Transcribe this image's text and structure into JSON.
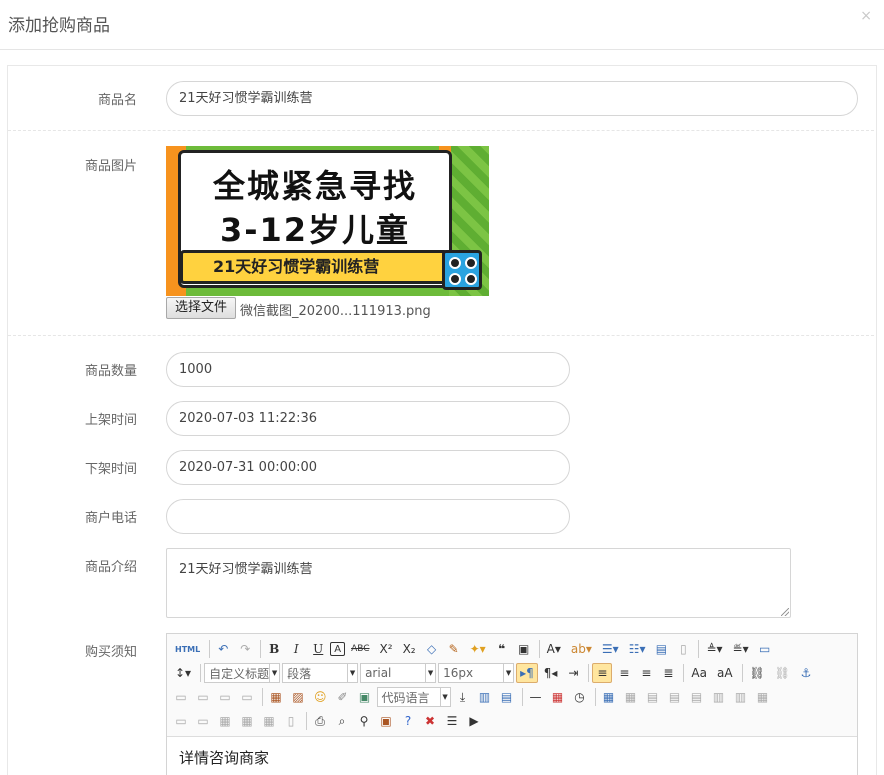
{
  "dialog": {
    "title": "添加抢购商品",
    "close": "×"
  },
  "form": {
    "name_label": "商品名",
    "name_value": "21天好习惯学霸训练营",
    "image_label": "商品图片",
    "image_text": {
      "line1": "全城紧急寻找",
      "line2": "3-12岁儿童",
      "ribbon": "21天好习惯学霸训练营"
    },
    "file_button": "选择文件",
    "file_name": "微信截图_20200...111913.png",
    "qty_label": "商品数量",
    "qty_value": "1000",
    "on_label": "上架时间",
    "on_value": "2020-07-03 11:22:36",
    "off_label": "下架时间",
    "off_value": "2020-07-31 00:00:00",
    "phone_label": "商户电话",
    "phone_value": "",
    "intro_label": "商品介绍",
    "intro_value": "21天好习惯学霸训练营",
    "notice_label": "购买须知"
  },
  "editor": {
    "toolbar": {
      "html": "HTML",
      "title_combo": "自定义标题",
      "paragraph_combo": "段落",
      "font_combo": "arial",
      "size_combo": "16px",
      "code_combo": "代码语言"
    },
    "content": "详情咨询商家"
  },
  "colors": {
    "active_button": "#ffe69f",
    "border": "#d6d6d6",
    "image_green": "#6dbb3a",
    "image_yellow": "#ffd23f",
    "image_orange": "#f7931e"
  }
}
